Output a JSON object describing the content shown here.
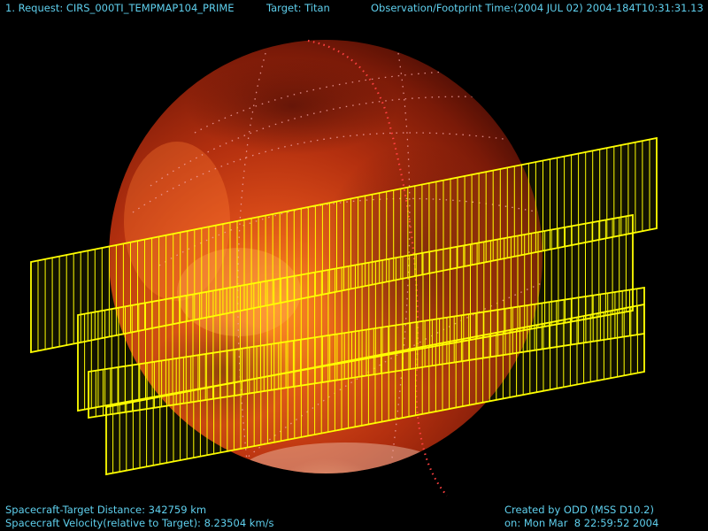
{
  "header": {
    "request": "1. Request: CIRS_000TI_TEMPMAP104_PRIME",
    "target": "Target: Titan",
    "time": "Observation/Footprint Time:(2004 JUL 02) 2004-184T10:31:31.13"
  },
  "footer": {
    "distance": "Spacecraft-Target Distance: 342759 km",
    "velocity": "Spacecraft Velocity(relative to Target): 8.23504 km/s",
    "created_by": "Created by ODD (MSS D10.2)",
    "created_on": "on: Mon Mar  8 22:59:52 2004"
  },
  "colors": {
    "hud_text": "#5fd0ee",
    "footprint": "#ffff00",
    "grid": "#f0a0a0",
    "limb_track": "#ff4040",
    "background": "#000000"
  },
  "scene": {
    "target_body": "Titan",
    "footprint_strips": 4
  }
}
